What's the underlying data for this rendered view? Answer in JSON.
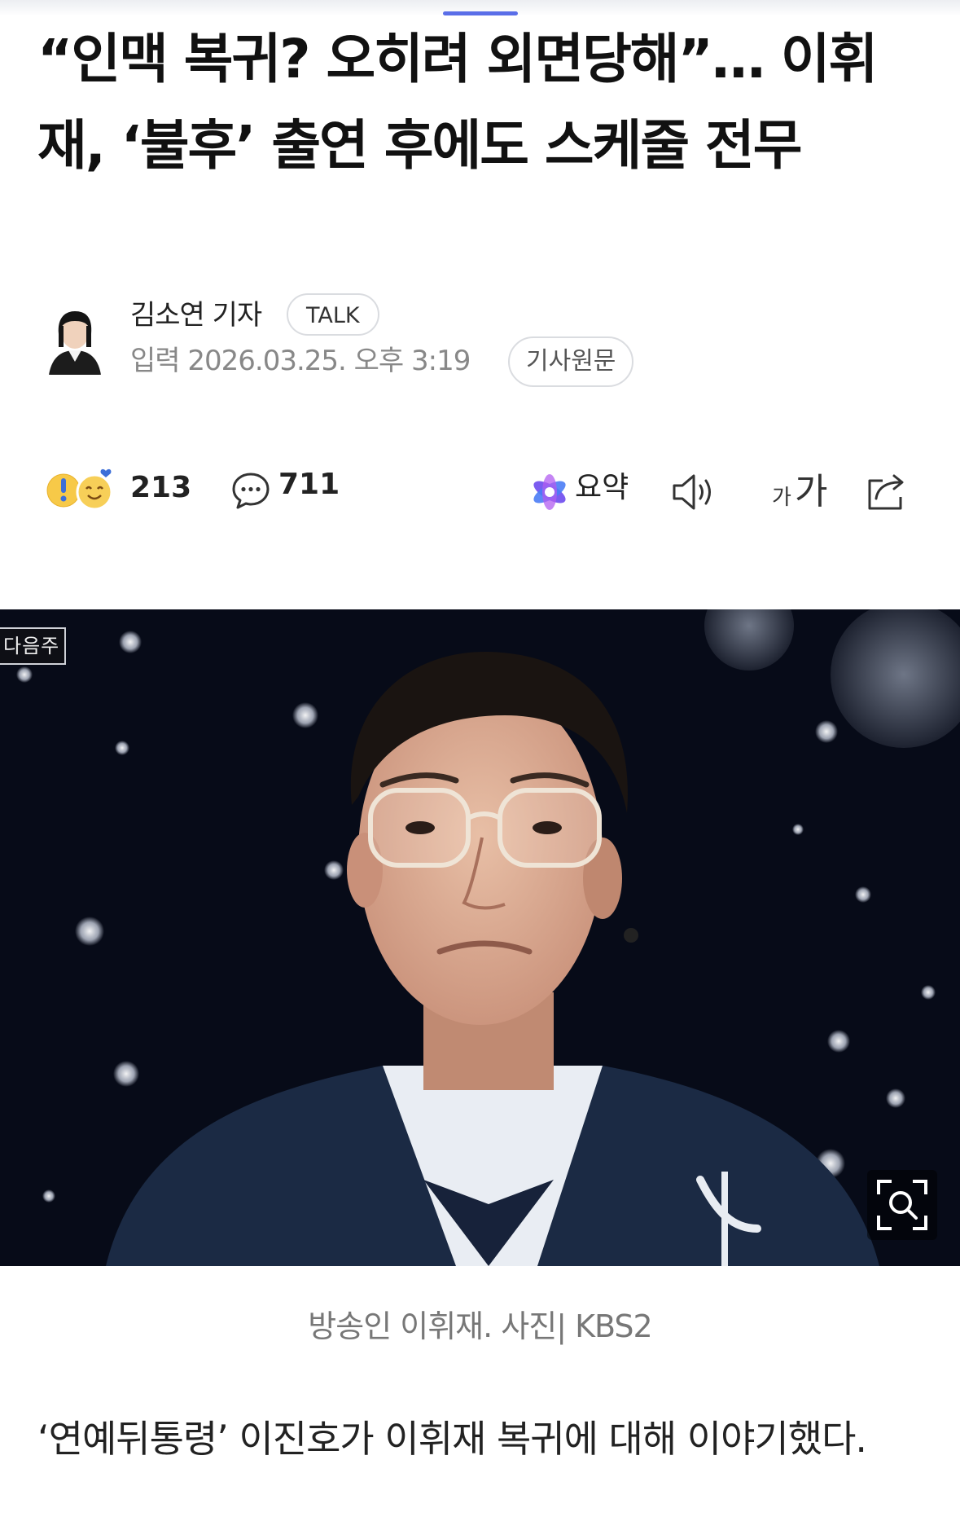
{
  "article": {
    "headline": "“인맥 복귀? 오히려 외면당해”… 이휘재, ‘불후’ 출연 후에도 스케줄 전무",
    "author": {
      "name": "김소연 기자",
      "talk_label": "TALK"
    },
    "published": {
      "label": "입력 2026.03.25. 오후 3:19",
      "original_label": "기사원문"
    },
    "toolbar": {
      "reaction_count": "213",
      "comment_count": "711",
      "summary_label": "요약",
      "font_small": "가",
      "font_large": "가",
      "icons": [
        "reaction-icon",
        "comment-icon",
        "ai-summary-icon",
        "speaker-icon",
        "font-size-icon",
        "share-icon"
      ]
    },
    "photo": {
      "badge": "다음주",
      "caption": "방송인 이휘재. 사진| KBS2",
      "zoom_icon": "zoom-icon"
    },
    "body": "‘연예뒤통령’ 이진호가 이휘재 복귀에 대해 이야기했다."
  },
  "colors": {
    "accent": "#5a6ee8",
    "text": "#111111",
    "muted": "#888888",
    "border": "#dadce0"
  }
}
